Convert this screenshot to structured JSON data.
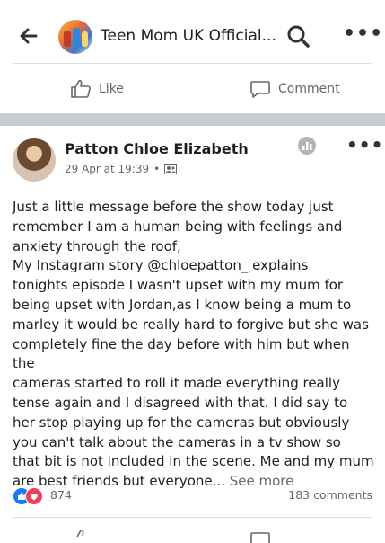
{
  "header": {
    "page_title": "Teen Mom UK Official...",
    "back_icon": "back-arrow-icon",
    "search_icon": "search-icon",
    "more_icon": "more-icon"
  },
  "top_actions": {
    "like_label": "Like",
    "comment_label": "Comment"
  },
  "post": {
    "author": "Patton Chloe Elizabeth",
    "timestamp": "29 Apr at 19:39",
    "separator": "•",
    "audience_icon": "audience-icon",
    "body_lines": [
      "Just a little message before the show today just",
      "remember I am a human being with feelings and",
      "anxiety through the roof,",
      "My Instagram story @chloepatton_ explains",
      "tonights episode I wasn't upset with my mum for",
      "being upset with Jordan,as I know being a mum to",
      "marley it would be really hard to forgive but she was",
      "completely fine the day before with him but when the",
      "cameras started to roll it made everything really",
      "tense again and I disagreed with that. I did say to",
      "her stop playing up for the cameras but obviously",
      "you can't talk about the cameras in a tv show so",
      "that bit is not included in the scene. Me and my mum",
      "are best friends but everyone..."
    ],
    "see_more": "See more",
    "reaction_count": "874",
    "comment_count": "183 comments"
  },
  "colors": {
    "like_blue": "#1877f2",
    "love_red": "#f33e58",
    "separator_gray": "#c9ccd1"
  }
}
